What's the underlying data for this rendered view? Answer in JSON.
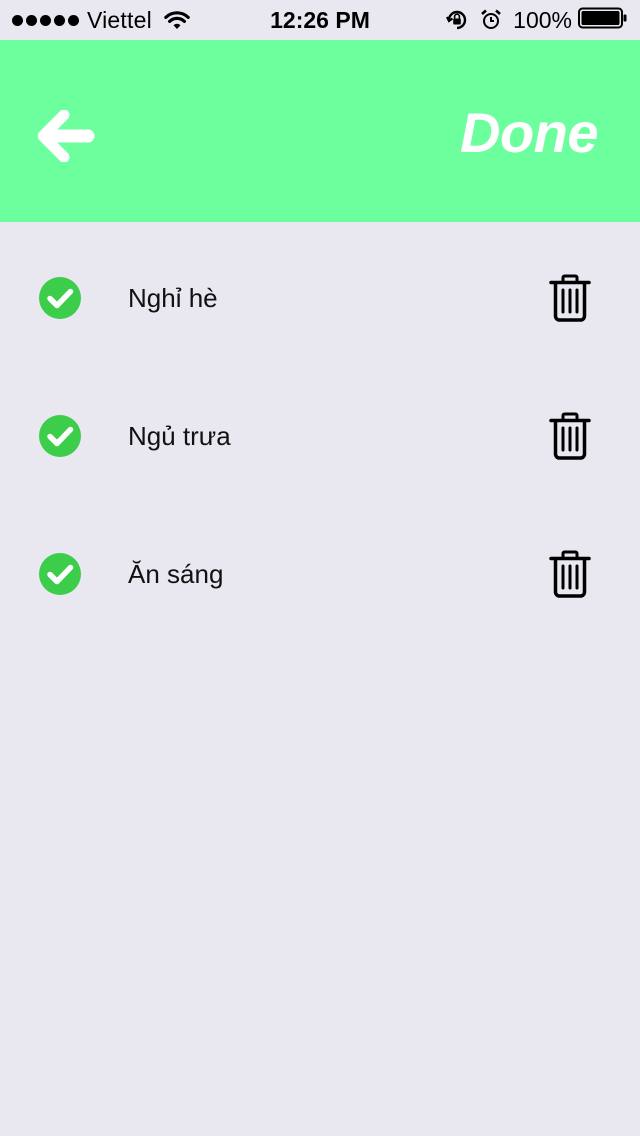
{
  "status_bar": {
    "carrier": "Viettel",
    "time": "12:26 PM",
    "battery": "100%",
    "icons": [
      "signal-dots-icon",
      "wifi-icon",
      "orientation-lock-icon",
      "alarm-icon",
      "battery-icon"
    ]
  },
  "header": {
    "back_icon": "arrow-left-icon",
    "done_label": "Done",
    "background_color": "#6dff9e"
  },
  "list": {
    "items": [
      {
        "label": "Nghỉ hè",
        "checked": true
      },
      {
        "label": "Ngủ trưa",
        "checked": true
      },
      {
        "label": "Ăn sáng",
        "checked": true
      }
    ],
    "check_color": "#3ccd4b",
    "item_icons": [
      "check-circle-icon",
      "trash-icon"
    ]
  }
}
